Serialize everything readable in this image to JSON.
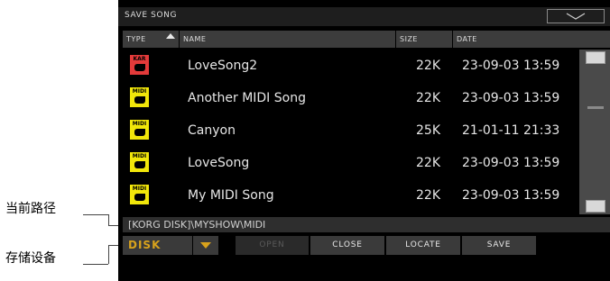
{
  "dialog": {
    "title": "SAVE SONG"
  },
  "columns": {
    "type": "TYPE",
    "name": "NAME",
    "size": "SIZE",
    "date": "DATE"
  },
  "files": [
    {
      "type": "KAR",
      "name": "LoveSong2",
      "size": "22K",
      "date": "23-09-03 13:59"
    },
    {
      "type": "MIDI",
      "name": "Another MIDI Song",
      "size": "22K",
      "date": "23-09-03 13:59"
    },
    {
      "type": "MIDI",
      "name": "Canyon",
      "size": "25K",
      "date": "21-01-11 21:33"
    },
    {
      "type": "MIDI",
      "name": "LoveSong",
      "size": "22K",
      "date": "23-09-03 13:59"
    },
    {
      "type": "MIDI",
      "name": "My MIDI Song",
      "size": "22K",
      "date": "23-09-03 13:59"
    }
  ],
  "path": "[KORG DISK]\\MYSHOW\\MIDI",
  "device": "DISK",
  "buttons": {
    "open": "OPEN",
    "close": "CLOSE",
    "locate": "LOCATE",
    "save": "SAVE"
  },
  "annotations": {
    "current_path": "当前路径",
    "storage_device": "存储设备"
  },
  "colors": {
    "kar_icon": "#e33a3a",
    "midi_icon": "#f1e60a",
    "device_text": "#d8a21c",
    "background": "#000000"
  }
}
